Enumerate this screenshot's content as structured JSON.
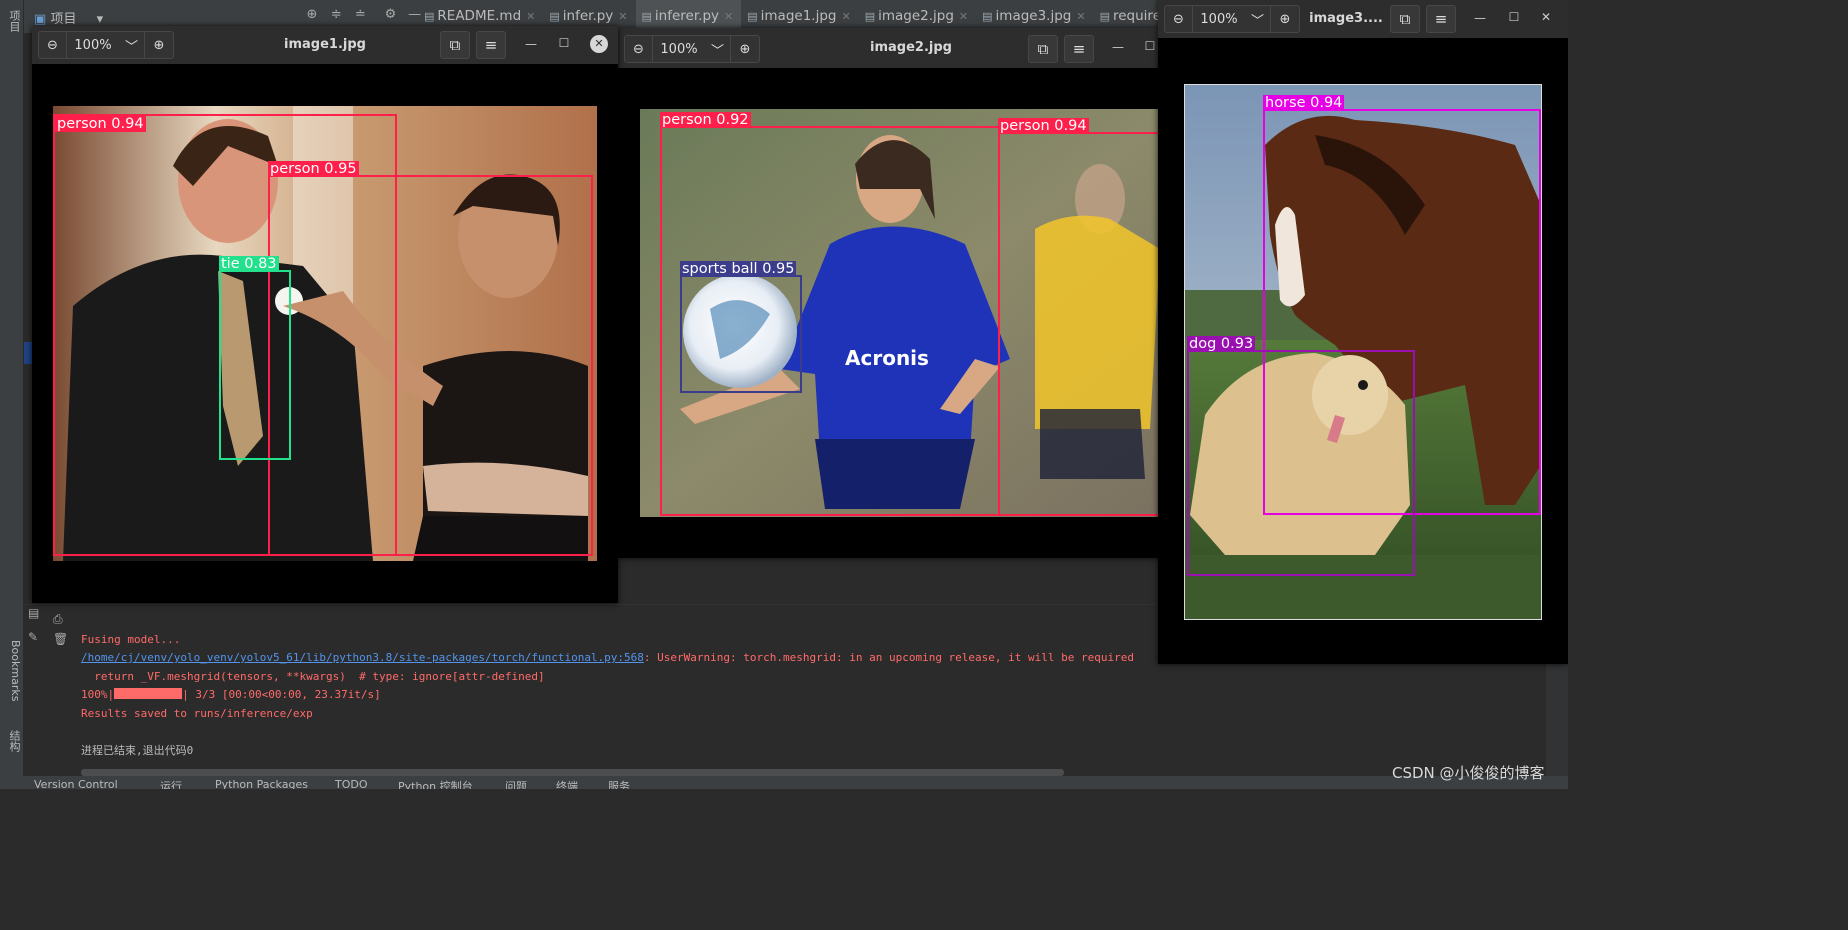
{
  "ide": {
    "left_strip": {
      "project_tab": "项目",
      "bookmarks_tab": "Bookmarks",
      "structure_tab": "结构"
    },
    "project_label": "项目",
    "tabs": [
      {
        "label": "README.md",
        "active": false
      },
      {
        "label": "infer.py",
        "active": false
      },
      {
        "label": "inferer.py",
        "active": true
      },
      {
        "label": "image1.jpg",
        "active": false
      },
      {
        "label": "image2.jpg",
        "active": false
      },
      {
        "label": "image3.jpg",
        "active": false
      },
      {
        "label": "requirements.txt",
        "active": false
      }
    ],
    "console": {
      "line1": "Fusing model...",
      "line2_link": "/home/cj/venv/yolo_venv/yolov5_61/lib/python3.8/site-packages/torch/functional.py:568",
      "line2_rest": ": UserWarning: torch.meshgrid: in an upcoming release, it will be required",
      "line3": "  return _VF.meshgrid(tensors, **kwargs)  # type: ignore[attr-defined]",
      "line4_prefix": "100%|",
      "line4_rest": "| 3/3 [00:00<00:00, 23.37it/s]",
      "line5": "Results saved to runs/inference/exp",
      "line6": "进程已结束,退出代码0"
    },
    "status_bar": {
      "version_control": "Version Control",
      "run": "运行",
      "python_packages": "Python Packages",
      "todo": "TODO",
      "python_console": "Python 控制台",
      "problems": "问题",
      "terminal": "终端",
      "services": "服务"
    },
    "watermark": "CSDN @小俊俊的博客"
  },
  "viewers": {
    "v1": {
      "title": "image1.jpg",
      "zoom": "100%",
      "detections": [
        {
          "label": "person 0.94",
          "color": "#ff1f4b"
        },
        {
          "label": "person 0.95",
          "color": "#ff1f4b"
        },
        {
          "label": "tie 0.83",
          "color": "#22e08c"
        }
      ]
    },
    "v2": {
      "title": "image2.jpg",
      "zoom": "100%",
      "detections": [
        {
          "label": "person 0.92",
          "color": "#ff1f4b"
        },
        {
          "label": "person 0.94",
          "color": "#ff1f4b"
        },
        {
          "label": "sports ball 0.95",
          "color": "#3c3c8c"
        }
      ]
    },
    "v3": {
      "title": "image3....",
      "zoom": "100%",
      "detections": [
        {
          "label": "horse 0.94",
          "color": "#e600e6"
        },
        {
          "label": "dog 0.93",
          "color": "#9a0fb0"
        }
      ]
    }
  }
}
